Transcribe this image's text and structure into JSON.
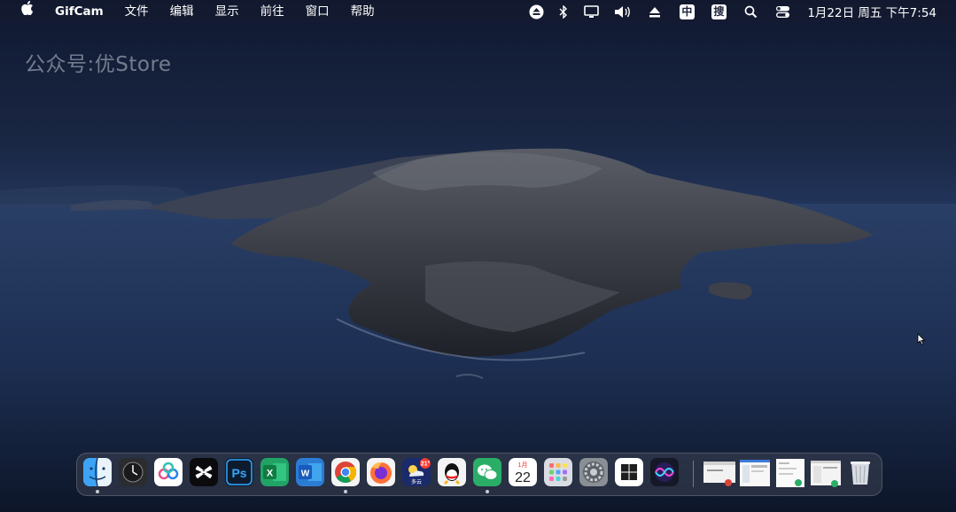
{
  "menubar": {
    "app_name": "GifCam",
    "menus": [
      "文件",
      "编辑",
      "显示",
      "前往",
      "窗口",
      "帮助"
    ],
    "status_icons": [
      "eject-circle-icon",
      "bluetooth-icon",
      "display-icon",
      "volume-icon",
      "eject-icon",
      "ime-icon",
      "sogou-icon",
      "search-icon",
      "control-center-icon"
    ],
    "ime_label": "中",
    "sogou_label": "搜",
    "clock": "1月22日 周五 下午7:54"
  },
  "watermark": "公众号:优Store",
  "dock": {
    "photoshop_label": "Ps",
    "excel_label": "X",
    "word_label": "W",
    "weather_badge": "21°",
    "weather_caption": "多云",
    "calendar_month": "1月",
    "calendar_day": "22"
  },
  "colors": {
    "desktop_sky": "#1a2744",
    "sea": "#1c2c4e",
    "menubar_text": "#ffffff",
    "dock_bg": "#3c4252"
  }
}
